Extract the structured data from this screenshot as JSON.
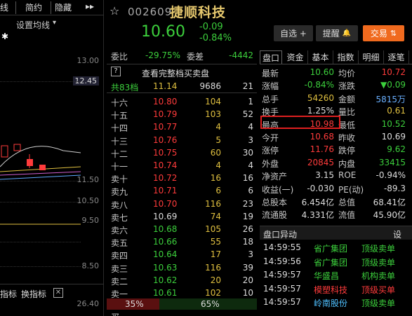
{
  "left_panel": {
    "tabs": [
      "线",
      "简约",
      "隐藏",
      "▸▸"
    ],
    "ma_setting": "设置均线",
    "price_ticks": [
      "13.00",
      "12.45",
      "11.50",
      "10.50",
      "9.50",
      "8.50",
      "26.40"
    ],
    "bottom_tabs": [
      "指标",
      "换指标"
    ],
    "colors": {
      "up": "#ff3b3b",
      "down": "#3ccf3c"
    }
  },
  "header": {
    "code": "002609",
    "name": "捷顺科技",
    "price": "10.60",
    "change": "-0.09",
    "change_pct": "-0.84%",
    "watchlist_btn": "自选 +",
    "alert_btn": "提醒",
    "trade_btn": "交易"
  },
  "book": {
    "wei_bi_label": "委比",
    "wei_bi": "-29.75%",
    "wei_cha_label": "委差",
    "wei_cha": "-4442",
    "question_mark": "?",
    "view_full": "查看完整档买卖盘",
    "total": {
      "label": "共83档",
      "price": "11.14",
      "vol": "9686",
      "chg": "21"
    },
    "sell": [
      {
        "label": "十六",
        "price": "10.80",
        "vol": "104",
        "chg": "1"
      },
      {
        "label": "十五",
        "price": "10.79",
        "vol": "103",
        "chg": "52"
      },
      {
        "label": "十四",
        "price": "10.77",
        "vol": "4",
        "chg": "4"
      },
      {
        "label": "十三",
        "price": "10.76",
        "vol": "5",
        "chg": "3"
      },
      {
        "label": "十二",
        "price": "10.75",
        "vol": "60",
        "chg": "30"
      },
      {
        "label": "十一",
        "price": "10.74",
        "vol": "4",
        "chg": "4"
      },
      {
        "label": "卖十",
        "price": "10.72",
        "vol": "16",
        "chg": "16"
      },
      {
        "label": "卖九",
        "price": "10.71",
        "vol": "6",
        "chg": "6"
      },
      {
        "label": "卖八",
        "price": "10.70",
        "vol": "116",
        "chg": "23"
      },
      {
        "label": "卖七",
        "price": "10.69",
        "vol": "74",
        "chg": "19"
      },
      {
        "label": "卖六",
        "price": "10.68",
        "vol": "105",
        "chg": "26"
      },
      {
        "label": "卖五",
        "price": "10.66",
        "vol": "55",
        "chg": "18"
      },
      {
        "label": "卖四",
        "price": "10.64",
        "vol": "17",
        "chg": "3"
      },
      {
        "label": "卖三",
        "price": "10.63",
        "vol": "116",
        "chg": "39"
      },
      {
        "label": "卖二",
        "price": "10.62",
        "vol": "20",
        "chg": "20"
      },
      {
        "label": "卖一",
        "price": "10.61",
        "vol": "102",
        "chg": "10"
      }
    ],
    "ratio_left": "35%",
    "ratio_right": "65%",
    "ratio_left_frac": 0.35,
    "partial_label": "买一"
  },
  "quote": {
    "tabs": [
      "盘口",
      "资金",
      "基本",
      "指数",
      "明细",
      "逐笔"
    ],
    "rows": [
      {
        "l1": "最新",
        "v1": "10.60",
        "c1": "#3ccf3c",
        "l2": "均价",
        "v2": "10.72",
        "c2": "#ff3b3b"
      },
      {
        "l1": "涨幅",
        "v1": "-0.84%",
        "c1": "#3ccf3c",
        "l2": "涨跌",
        "v2": "▼0.09",
        "c2": "#3ccf3c"
      },
      {
        "l1": "总手",
        "v1": "54260",
        "c1": "#e0c040",
        "l2": "金额",
        "v2": "5815万",
        "c2": "#6ab0ff"
      },
      {
        "l1": "换手",
        "v1": "1.25%",
        "c1": "#dddddd",
        "l2": "量比",
        "v2": "0.61",
        "c2": "#e0c040"
      },
      {
        "l1": "最高",
        "v1": "10.98",
        "c1": "#ff3b3b",
        "l2": "最低",
        "v2": "10.52",
        "c2": "#3ccf3c"
      },
      {
        "l1": "今开",
        "v1": "10.68",
        "c1": "#ff3b3b",
        "l2": "昨收",
        "v2": "10.69",
        "c2": "#dddddd"
      },
      {
        "l1": "涨停",
        "v1": "11.76",
        "c1": "#ff3b3b",
        "l2": "跌停",
        "v2": "9.62",
        "c2": "#3ccf3c"
      },
      {
        "l1": "外盘",
        "v1": "20845",
        "c1": "#ff3b3b",
        "l2": "内盘",
        "v2": "33415",
        "c2": "#3ccf3c"
      },
      {
        "l1": "净资产",
        "v1": "3.15",
        "c1": "#dddddd",
        "l2": "ROE",
        "v2": "-0.94%",
        "c2": "#dddddd"
      },
      {
        "l1": "收益(一)",
        "v1": "-0.030",
        "c1": "#dddddd",
        "l2": "PE(动)",
        "v2": "-89.3",
        "c2": "#dddddd"
      },
      {
        "l1": "总股本",
        "v1": "6.454亿",
        "c1": "#dddddd",
        "l2": "总值",
        "v2": "68.41亿",
        "c2": "#dddddd"
      },
      {
        "l1": "流通股",
        "v1": "4.331亿",
        "c1": "#dddddd",
        "l2": "流值",
        "v2": "45.90亿",
        "c2": "#dddddd"
      }
    ],
    "section_title": "盘口异动",
    "section_btn": "设",
    "trades": [
      {
        "time": "14:59:55",
        "name": "省广集团",
        "name_color": "#3ccf3c",
        "kind": "顶级卖单",
        "kind_color": "#3ccf3c"
      },
      {
        "time": "14:59:56",
        "name": "省广集团",
        "name_color": "#3ccf3c",
        "kind": "顶级卖单",
        "kind_color": "#3ccf3c"
      },
      {
        "time": "14:59:57",
        "name": "华盛昌",
        "name_color": "#3ccf3c",
        "kind": "机构卖单",
        "kind_color": "#3ccf3c"
      },
      {
        "time": "14:59:57",
        "name": "模塑科技",
        "name_color": "#ff3b3b",
        "kind": "顶级买单",
        "kind_color": "#ff3b3b"
      },
      {
        "time": "14:59:57",
        "name": "岭南股份",
        "name_color": "#4fc0ff",
        "kind": "顶级卖单",
        "kind_color": "#3ccf3c"
      }
    ]
  }
}
